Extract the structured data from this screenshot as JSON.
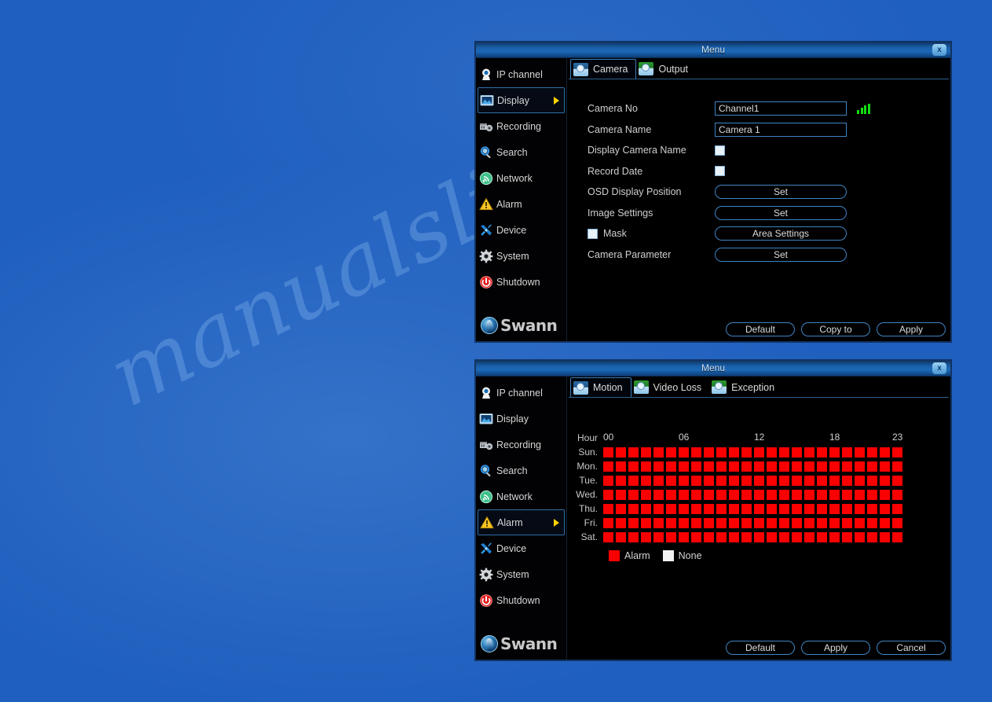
{
  "background": {
    "color": "#1f5fbe",
    "watermark": "manualslib.com"
  },
  "colors": {
    "accent_blue": "#3f84c4",
    "titlebar_blue": "#1a5fa8",
    "alarm_red": "#fb0000",
    "none_white": "#f2f2f2",
    "arrow_yellow": "#ffd200",
    "signal_green": "#12e012"
  },
  "sidebar": {
    "logo_text": "Swann",
    "items": [
      {
        "label": "IP channel",
        "icon": "ip-camera-icon"
      },
      {
        "label": "Display",
        "icon": "display-icon"
      },
      {
        "label": "Recording",
        "icon": "recording-icon"
      },
      {
        "label": "Search",
        "icon": "magnifier-icon"
      },
      {
        "label": "Network",
        "icon": "network-icon"
      },
      {
        "label": "Alarm",
        "icon": "warning-triangle-icon"
      },
      {
        "label": "Device",
        "icon": "tools-icon"
      },
      {
        "label": "System",
        "icon": "gear-icon"
      },
      {
        "label": "Shutdown",
        "icon": "power-icon"
      }
    ]
  },
  "window_display": {
    "title": "Menu",
    "close_label": "x",
    "selected_sidebar": "Display",
    "tabs": [
      {
        "label": "Camera",
        "icon": "camera-tab-icon",
        "active": true
      },
      {
        "label": "Output",
        "icon": "output-tab-icon",
        "active": false
      }
    ],
    "form": {
      "camera_no": {
        "label": "Camera No",
        "value": "Channel1",
        "options": [
          "Channel1"
        ]
      },
      "camera_name": {
        "label": "Camera Name",
        "value": "Camera 1",
        "placeholder": "Camera 1"
      },
      "display_camera_name": {
        "label": "Display Camera Name",
        "checked": false
      },
      "record_date": {
        "label": "Record Date",
        "checked": false
      },
      "osd_display_position": {
        "label": "OSD Display Position",
        "button": "Set"
      },
      "image_settings": {
        "label": "Image Settings",
        "button": "Set"
      },
      "mask": {
        "label": "Mask",
        "checked": false,
        "button": "Area Settings"
      },
      "camera_parameter": {
        "label": "Camera Parameter",
        "button": "Set"
      }
    },
    "footer_buttons": [
      "Default",
      "Copy to",
      "Apply"
    ]
  },
  "window_alarm": {
    "title": "Menu",
    "close_label": "x",
    "selected_sidebar": "Alarm",
    "tabs": [
      {
        "label": "Motion",
        "icon": "motion-tab-icon",
        "active": true
      },
      {
        "label": "Video Loss",
        "icon": "videoloss-tab-icon",
        "active": false
      },
      {
        "label": "Exception",
        "icon": "exception-tab-icon",
        "active": false
      }
    ],
    "schedule": {
      "hour_label": "Hour",
      "hour_ticks": [
        "00",
        "06",
        "12",
        "18",
        "23"
      ],
      "days": [
        "Sun.",
        "Mon.",
        "Tue.",
        "Wed.",
        "Thu.",
        "Fri.",
        "Sat."
      ],
      "hours": 24,
      "legend": [
        {
          "label": "Alarm",
          "state": "alarm"
        },
        {
          "label": "None",
          "state": "none"
        }
      ],
      "cells": [
        [
          "alarm",
          "alarm",
          "alarm",
          "alarm",
          "alarm",
          "alarm",
          "alarm",
          "alarm",
          "alarm",
          "alarm",
          "alarm",
          "alarm",
          "alarm",
          "alarm",
          "alarm",
          "alarm",
          "alarm",
          "alarm",
          "alarm",
          "alarm",
          "alarm",
          "alarm",
          "alarm",
          "alarm"
        ],
        [
          "alarm",
          "alarm",
          "alarm",
          "alarm",
          "alarm",
          "alarm",
          "alarm",
          "alarm",
          "alarm",
          "alarm",
          "alarm",
          "alarm",
          "alarm",
          "alarm",
          "alarm",
          "alarm",
          "alarm",
          "alarm",
          "alarm",
          "alarm",
          "alarm",
          "alarm",
          "alarm",
          "alarm"
        ],
        [
          "alarm",
          "alarm",
          "alarm",
          "alarm",
          "alarm",
          "alarm",
          "alarm",
          "alarm",
          "alarm",
          "alarm",
          "alarm",
          "alarm",
          "alarm",
          "alarm",
          "alarm",
          "alarm",
          "alarm",
          "alarm",
          "alarm",
          "alarm",
          "alarm",
          "alarm",
          "alarm",
          "alarm"
        ],
        [
          "alarm",
          "alarm",
          "alarm",
          "alarm",
          "alarm",
          "alarm",
          "alarm",
          "alarm",
          "alarm",
          "alarm",
          "alarm",
          "alarm",
          "alarm",
          "alarm",
          "alarm",
          "alarm",
          "alarm",
          "alarm",
          "alarm",
          "alarm",
          "alarm",
          "alarm",
          "alarm",
          "alarm"
        ],
        [
          "alarm",
          "alarm",
          "alarm",
          "alarm",
          "alarm",
          "alarm",
          "alarm",
          "alarm",
          "alarm",
          "alarm",
          "alarm",
          "alarm",
          "alarm",
          "alarm",
          "alarm",
          "alarm",
          "alarm",
          "alarm",
          "alarm",
          "alarm",
          "alarm",
          "alarm",
          "alarm",
          "alarm"
        ],
        [
          "alarm",
          "alarm",
          "alarm",
          "alarm",
          "alarm",
          "alarm",
          "alarm",
          "alarm",
          "alarm",
          "alarm",
          "alarm",
          "alarm",
          "alarm",
          "alarm",
          "alarm",
          "alarm",
          "alarm",
          "alarm",
          "alarm",
          "alarm",
          "alarm",
          "alarm",
          "alarm",
          "alarm"
        ],
        [
          "alarm",
          "alarm",
          "alarm",
          "alarm",
          "alarm",
          "alarm",
          "alarm",
          "alarm",
          "alarm",
          "alarm",
          "alarm",
          "alarm",
          "alarm",
          "alarm",
          "alarm",
          "alarm",
          "alarm",
          "alarm",
          "alarm",
          "alarm",
          "alarm",
          "alarm",
          "alarm",
          "alarm"
        ]
      ]
    },
    "footer_buttons": [
      "Default",
      "Apply",
      "Cancel"
    ]
  }
}
